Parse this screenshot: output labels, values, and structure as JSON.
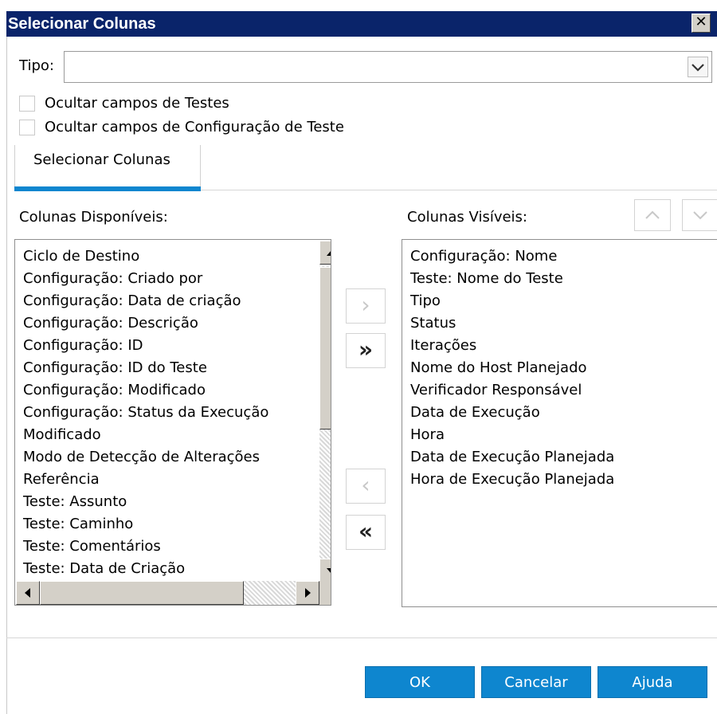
{
  "dialog": {
    "title": "Selecionar Colunas",
    "close_glyph": "✕"
  },
  "tipo": {
    "label": "Tipo:",
    "value": ""
  },
  "checkboxes": [
    {
      "label": "Ocultar campos de Testes",
      "checked": false
    },
    {
      "label": "Ocultar campos de Configuração de Teste",
      "checked": false
    }
  ],
  "tab": {
    "label": "Selecionar Colunas"
  },
  "available": {
    "label": "Colunas Disponíveis:",
    "items": [
      "Ciclo de Destino",
      "Configuração: Criado por",
      "Configuração: Data de criação",
      "Configuração: Descrição",
      "Configuração: ID",
      "Configuração: ID do Teste",
      "Configuração: Modificado",
      "Configuração: Status da Execução",
      "Modificado",
      "Modo de Detecção de Alterações",
      "Referência",
      "Teste: Assunto",
      "Teste: Caminho",
      "Teste: Comentários",
      "Teste: Data de Criação"
    ]
  },
  "visible": {
    "label": "Colunas Visíveis:",
    "items": [
      "Configuração: Nome",
      "Teste: Nome do Teste",
      "Tipo",
      "Status",
      "Iterações",
      "Nome do Host Planejado",
      "Verificador Responsável",
      "Data de Execução",
      "Hora",
      "Data de Execução Planejada",
      "Hora de Execução Planejada"
    ]
  },
  "move": {
    "add_one": "›",
    "add_all": "»",
    "remove_one": "‹",
    "remove_all": "«"
  },
  "buttons": {
    "ok": "OK",
    "cancel": "Cancelar",
    "help": "Ajuda"
  },
  "colors": {
    "title_bar": "#0a246a",
    "accent": "#0e86cf"
  }
}
